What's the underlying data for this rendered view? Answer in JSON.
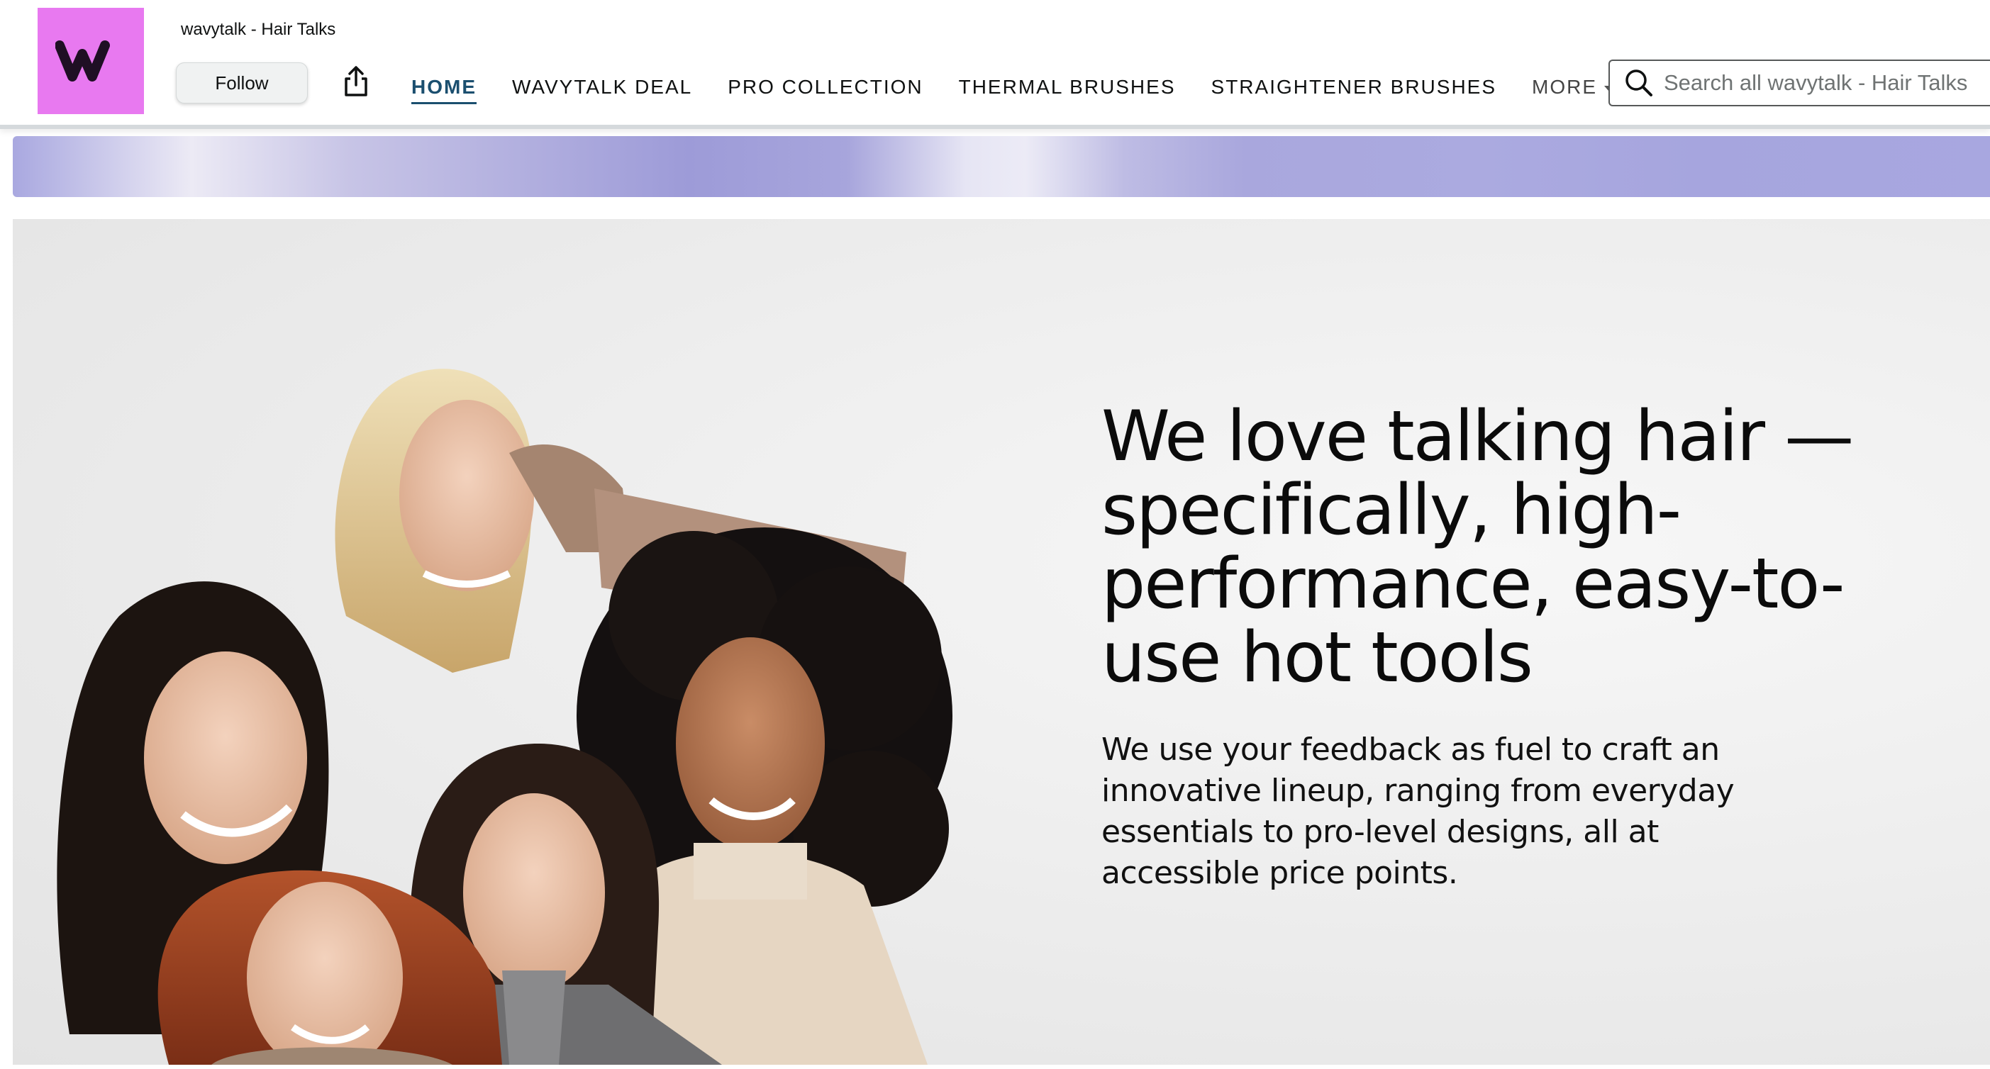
{
  "store": {
    "name": "wavytalk - Hair Talks",
    "logo_letter": "w",
    "brand_color": "#e879f0"
  },
  "header": {
    "follow_label": "Follow",
    "share_icon": "share-icon"
  },
  "nav": {
    "items": [
      {
        "label": "HOME",
        "active": true
      },
      {
        "label": "WAVYTALK DEAL",
        "active": false
      },
      {
        "label": "PRO COLLECTION",
        "active": false
      },
      {
        "label": "THERMAL BRUSHES",
        "active": false
      },
      {
        "label": "STRAIGHTENER BRUSHES",
        "active": false
      },
      {
        "label": "MORE",
        "active": false
      }
    ],
    "active_color": "#1b4f6f"
  },
  "search": {
    "placeholder": "Search all wavytalk - Hair Talks",
    "icon": "search-icon"
  },
  "hero": {
    "headline": "We love talking hair — specifically, high-performance, easy-to-use hot tools",
    "subtext": "We use your feedback as fuel to craft an innovative lineup, ranging from everyday essentials to pro-level designs, all at accessible price points."
  }
}
